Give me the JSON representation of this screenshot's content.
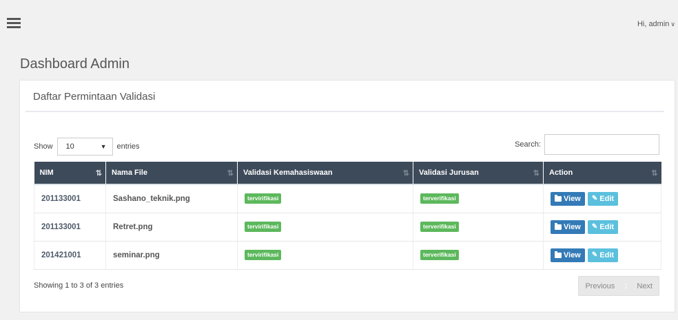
{
  "header": {
    "user_greeting": "Hi, admin",
    "caret": "∨"
  },
  "page": {
    "title": "Dashboard Admin"
  },
  "panel": {
    "title": "Daftar Permintaan Validasi"
  },
  "table_controls": {
    "show_label": "Show",
    "entries_value": "10",
    "entries_label": "entries",
    "search_label": "Search:",
    "search_value": "",
    "dropdown_arrow": "▼"
  },
  "table": {
    "columns": [
      "NIM",
      "Nama File",
      "Validasi Kemahasiswaan",
      "Validasi Jurusan",
      "Action"
    ],
    "rows": [
      {
        "nim": "201133001",
        "file": "Sashano_teknik.png",
        "validasi_kemahasiswaan": "tervirifikasi",
        "validasi_jurusan": "terverifikasi"
      },
      {
        "nim": "201133001",
        "file": "Retret.png",
        "validasi_kemahasiswaan": "tervirifikasi",
        "validasi_jurusan": "terverifikasi"
      },
      {
        "nim": "201421001",
        "file": "seminar.png",
        "validasi_kemahasiswaan": "tervirifikasi",
        "validasi_jurusan": "terverifikasi"
      }
    ],
    "actions": {
      "view_label": "View",
      "edit_label": "Edit"
    }
  },
  "footer": {
    "info": "Showing 1 to 3 of 3 entries",
    "previous_label": "Previous",
    "current_page": "1",
    "next_label": "Next"
  },
  "colors": {
    "table_header": "#3d4a5a",
    "badge_success": "#5cb85c",
    "btn_view": "#337ab7",
    "btn_edit": "#5bc0de"
  },
  "icons": {
    "menu": "hamburger-icon",
    "view": "folder-icon",
    "edit": "pencil-icon",
    "sort": "sort-icon"
  }
}
